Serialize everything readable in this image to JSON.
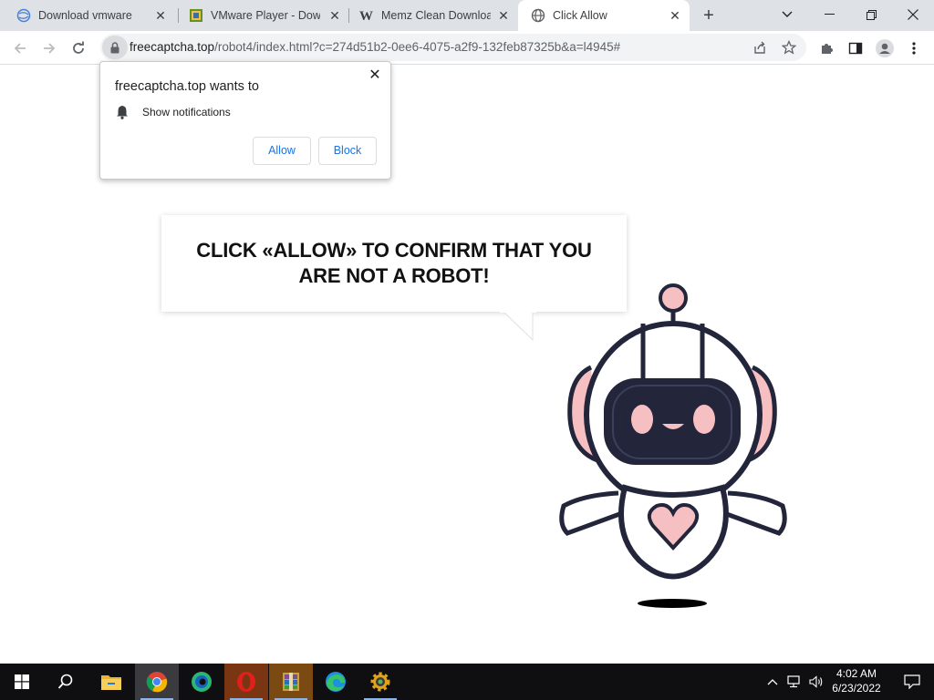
{
  "browser": {
    "tabs": [
      {
        "title": "Download vmware",
        "favicon": "globe-swirl-icon",
        "active": false
      },
      {
        "title": "VMware Player - Downl",
        "favicon": "vmware-icon",
        "active": false
      },
      {
        "title": "Memz Clean Download",
        "favicon": "w-logo-icon",
        "active": false
      },
      {
        "title": "Click Allow",
        "favicon": "globe-icon",
        "active": true
      }
    ],
    "new_tab_label": "+",
    "url_host": "freecaptcha.top",
    "url_path": "/robot4/index.html?c=274d51b2-0ee6-4075-a2f9-132feb87325b&a=l4945#"
  },
  "permission_prompt": {
    "title": "freecaptcha.top wants to",
    "permission": "Show notifications",
    "allow_label": "Allow",
    "block_label": "Block",
    "close_label": "✕"
  },
  "page": {
    "headline": "CLICK «ALLOW» TO CONFIRM THAT YOU ARE NOT A ROBOT!",
    "colors": {
      "robot_pink": "#f6c0c2",
      "robot_navy": "#23263b"
    }
  },
  "taskbar": {
    "apps": [
      "start-icon",
      "search-icon",
      "file-explorer-icon",
      "chrome-icon",
      "edge-dev-icon",
      "opera-icon",
      "winrar-icon",
      "edge-icon",
      "settings-gear-icon"
    ],
    "time": "4:02 AM",
    "date": "6/23/2022"
  }
}
